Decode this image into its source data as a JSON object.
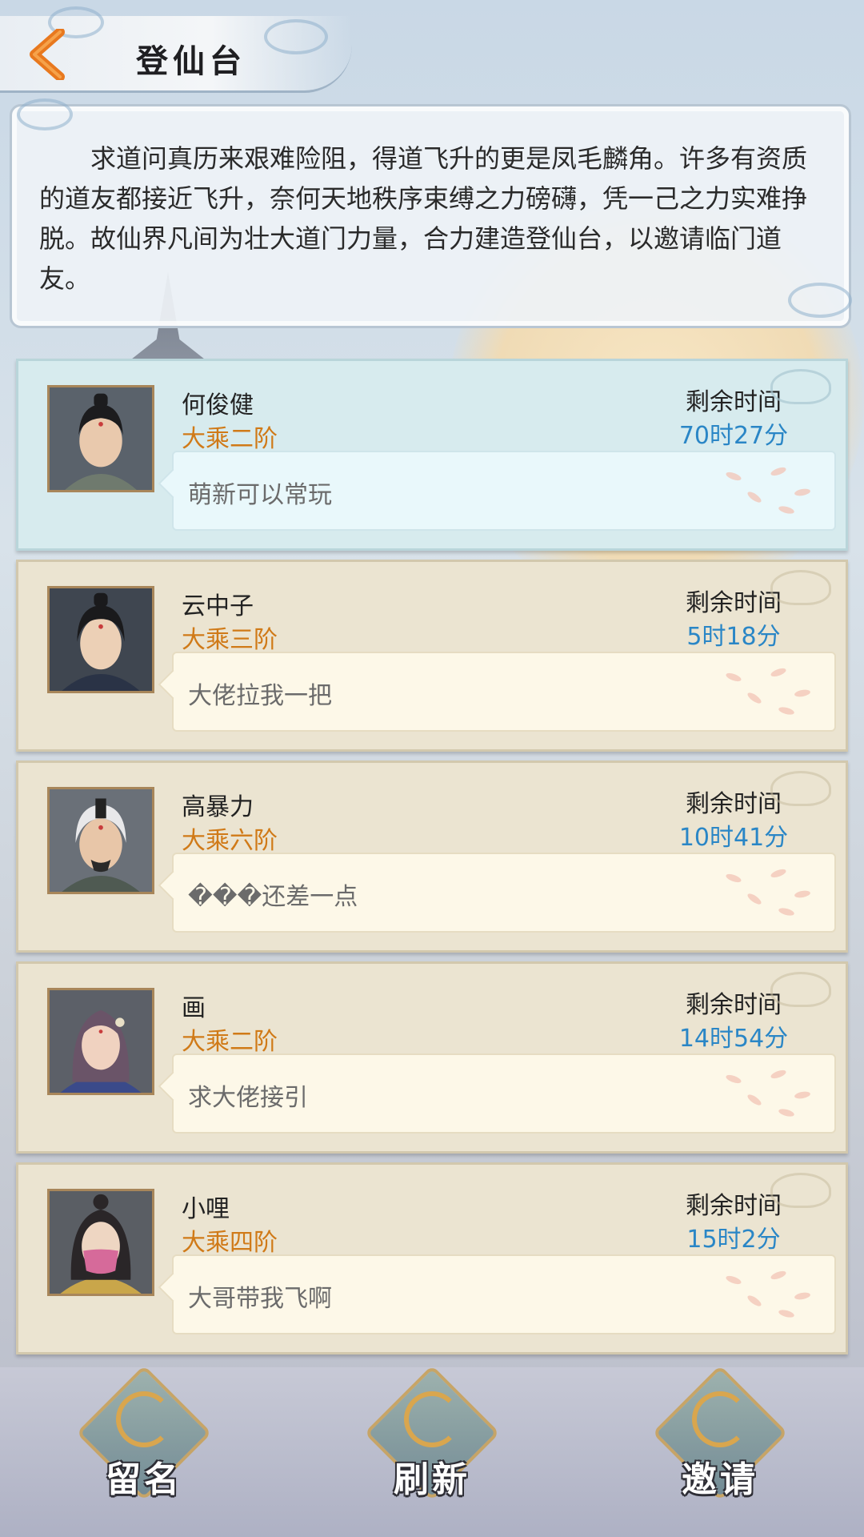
{
  "header": {
    "title": "登仙台"
  },
  "intro": {
    "text": "求道问真历来艰难险阻，得道飞升的更是凤毛麟角。许多有资质的道友都接近飞升，奈何天地秩序束缚之力磅礴，凭一己之力实难挣脱。故仙界凡间为壮大道门力量，合力建造登仙台，以邀请临门道友。"
  },
  "players": [
    {
      "name": "何俊健",
      "rank": "大乘二阶",
      "time_label": "剩余时间",
      "time_left": "70时27分",
      "message": "萌新可以常玩"
    },
    {
      "name": "云中子",
      "rank": "大乘三阶",
      "time_label": "剩余时间",
      "time_left": "5时18分",
      "message": "大佬拉我一把"
    },
    {
      "name": "高暴力",
      "rank": "大乘六阶",
      "time_label": "剩余时间",
      "time_left": "10时41分",
      "message": "���还差一点"
    },
    {
      "name": "画",
      "rank": "大乘二阶",
      "time_label": "剩余时间",
      "time_left": "14时54分",
      "message": "求大佬接引"
    },
    {
      "name": "小哩",
      "rank": "大乘四阶",
      "time_label": "剩余时间",
      "time_left": "15时2分",
      "message": "大哥带我飞啊"
    }
  ],
  "actions": {
    "sign": "留名",
    "refresh": "刷新",
    "invite": "邀请"
  },
  "colors": {
    "rank": "#d07a18",
    "time": "#2a86c6",
    "back_arrow": "#e8781e"
  }
}
